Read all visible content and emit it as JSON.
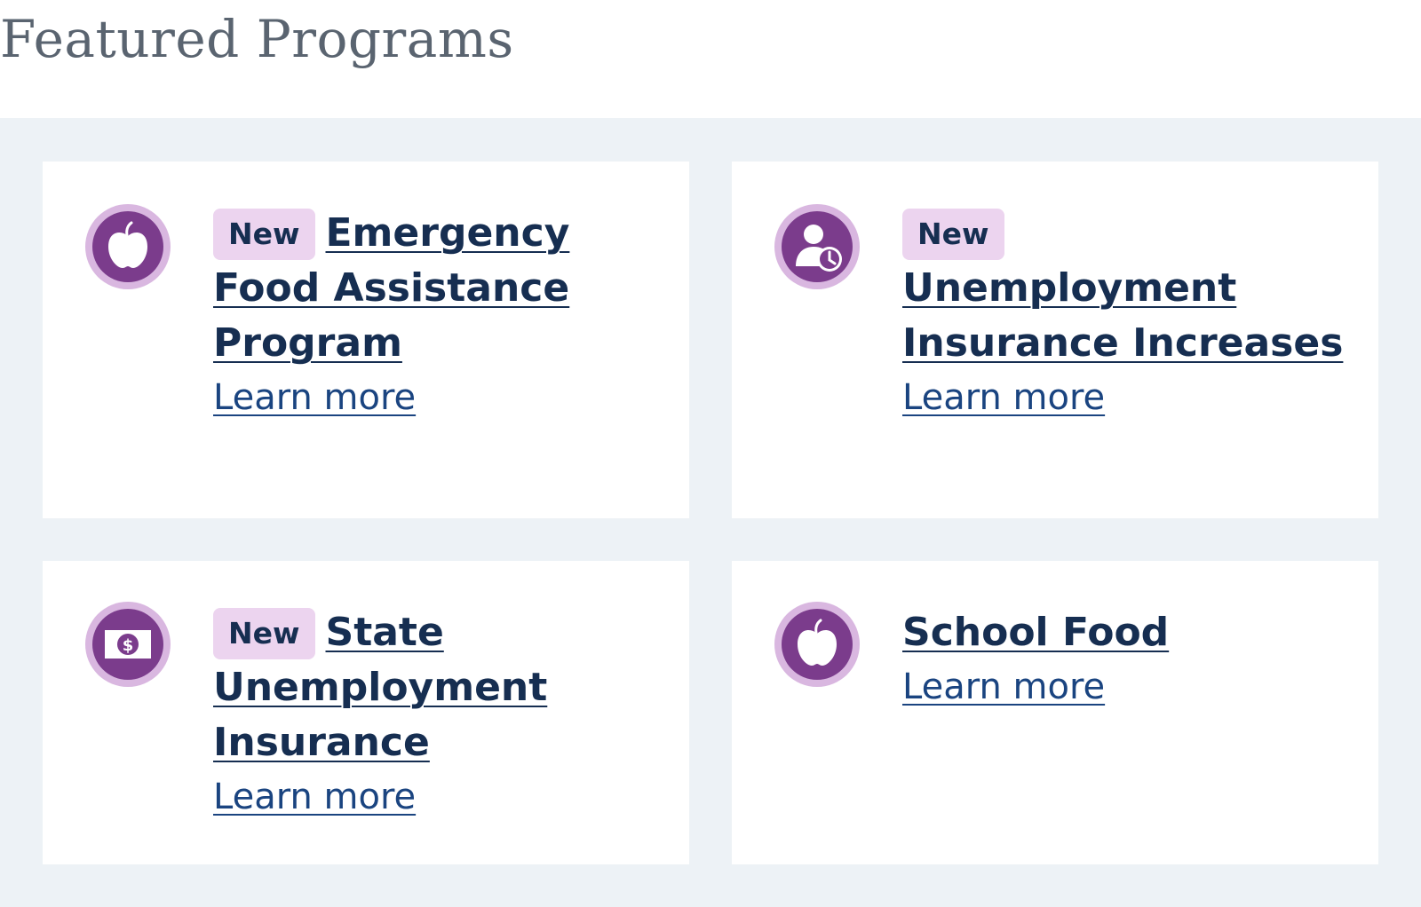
{
  "section": {
    "title": "Featured Programs"
  },
  "cards": [
    {
      "icon": "apple-icon",
      "badge": "New",
      "title": "Emergency Food Assistance Program",
      "link_label": "Learn more"
    },
    {
      "icon": "person-clock-icon",
      "badge": "New",
      "title": "Unemployment Insurance Increases",
      "link_label": "Learn more"
    },
    {
      "icon": "dollar-bill-icon",
      "badge": "New",
      "title": "State Unemployment Insurance",
      "link_label": "Learn more"
    },
    {
      "icon": "apple-icon",
      "badge": "",
      "title": "School Food",
      "link_label": "Learn more"
    }
  ],
  "colors": {
    "heading_text": "#162e51",
    "link_text": "#1a4480",
    "badge_bg": "#ecd4ef",
    "icon_core": "#7b3c8c",
    "icon_ring": "#d9b7e0",
    "grid_bg": "#edf2f6",
    "title_gray": "#5a6470"
  }
}
